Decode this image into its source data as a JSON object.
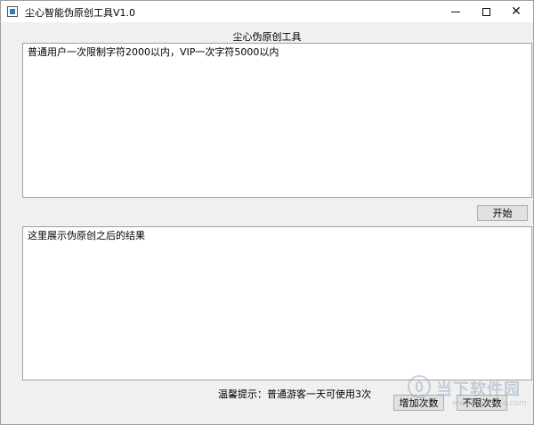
{
  "window": {
    "title": "尘心智能伪原创工具V1.0"
  },
  "main": {
    "heading": "尘心伪原创工具",
    "input_text": "普通用户一次限制字符2000以内，VIP一次字符5000以内",
    "output_text": "这里展示伪原创之后的结果",
    "start_label": "开始",
    "hint_text": "温馨提示：普通游客一天可使用3次",
    "add_label": "增加次数",
    "unlimited_label": "不限次数"
  },
  "watermark": {
    "text": "当下软件园",
    "url": "www.downxia.com"
  }
}
